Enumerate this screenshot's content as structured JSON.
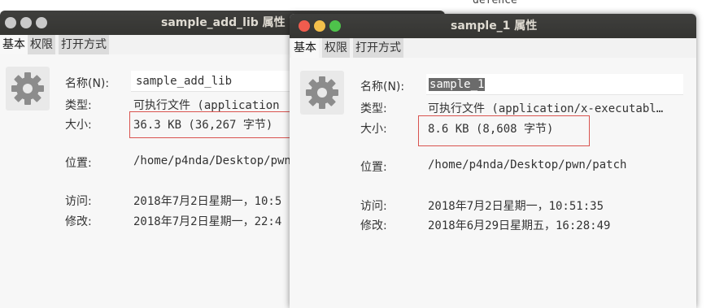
{
  "background": {
    "text": "defence"
  },
  "win1": {
    "title": "sample_add_lib 属性",
    "tabs": [
      "基本",
      "权限",
      "打开方式"
    ],
    "name_label": "名称(N):",
    "name_value": "sample_add_lib",
    "type_label": "类型:",
    "type_value": "可执行文件 (application",
    "size_label": "大小:",
    "size_value": "36.3 KB (36,267 字节)",
    "location_label": "位置:",
    "location_value": "/home/p4nda/Desktop/pwn",
    "accessed_label": "访问:",
    "accessed_value": "2018年7月2日星期一，10:5",
    "modified_label": "修改:",
    "modified_value": "2018年7月2日星期一，22:4"
  },
  "win2": {
    "title": "sample_1 属性",
    "tabs": [
      "基本",
      "权限",
      "打开方式"
    ],
    "name_label": "名称(N):",
    "name_value": "sample_1",
    "type_label": "类型:",
    "type_value": "可执行文件 (application/x-executabl…",
    "size_label": "大小:",
    "size_value": "8.6 KB (8,608 字节)",
    "location_label": "位置:",
    "location_value": "/home/p4nda/Desktop/pwn/patch",
    "accessed_label": "访问:",
    "accessed_value": "2018年7月2日星期一，10:51:35",
    "modified_label": "修改:",
    "modified_value": "2018年6月29日星期五，16:28:49"
  },
  "icons": {
    "file": "gear-icon",
    "close": "close-icon",
    "minimize": "minimize-icon",
    "maximize": "maximize-icon"
  },
  "colors": {
    "titlebar": "#3c3b37",
    "close_active": "#f05c4e",
    "minimize_active": "#f3bf4b",
    "maximize_active": "#4ec34b",
    "inactive_button": "#c9c9c9",
    "highlight_box": "#d9534f"
  }
}
